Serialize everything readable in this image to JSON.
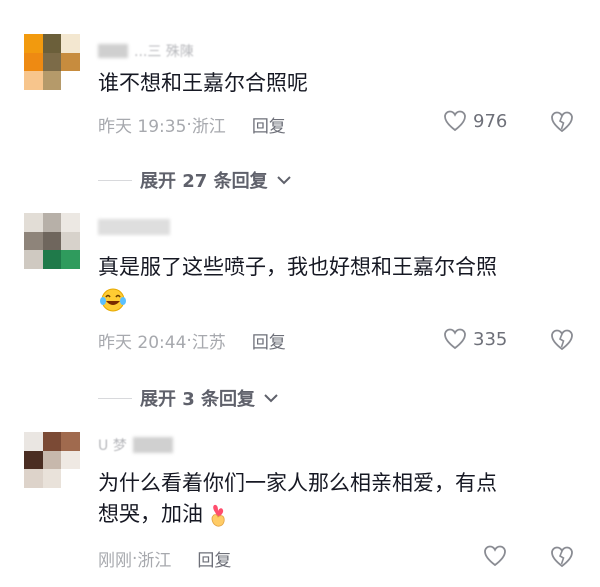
{
  "comments": [
    {
      "username": "...三 殊陳",
      "text": "谁不想和王嘉尔合照呢",
      "time": "昨天 19:35",
      "location": "浙江",
      "reply_label": "回复",
      "likes": "976",
      "expand_label": "展开 27 条回复",
      "avatar_icon": "pixelated-avatar"
    },
    {
      "username": "",
      "text": "真是服了这些喷子，我也好想和王嘉尔合照",
      "emoji": "laughing-crying-emoji",
      "time": "昨天 20:44",
      "location": "江苏",
      "reply_label": "回复",
      "likes": "335",
      "expand_label": "展开 3 条回复",
      "avatar_icon": "pixelated-avatar"
    },
    {
      "username": "U 梦",
      "text": "为什么看着你们一家人那么相亲相爱，有点",
      "text_line2": "想哭，加油",
      "emoji": "finger-heart-emoji",
      "time": "刚刚",
      "location": "浙江",
      "reply_label": "回复",
      "likes": "",
      "avatar_icon": "pixelated-avatar"
    }
  ],
  "icons": {
    "like": "heart-outline-icon",
    "dislike": "broken-heart-outline-icon",
    "expand": "chevron-down-icon"
  },
  "colors": {
    "text_primary": "#161823",
    "text_meta": "#a7a9ae",
    "text_action": "#6e7079"
  }
}
